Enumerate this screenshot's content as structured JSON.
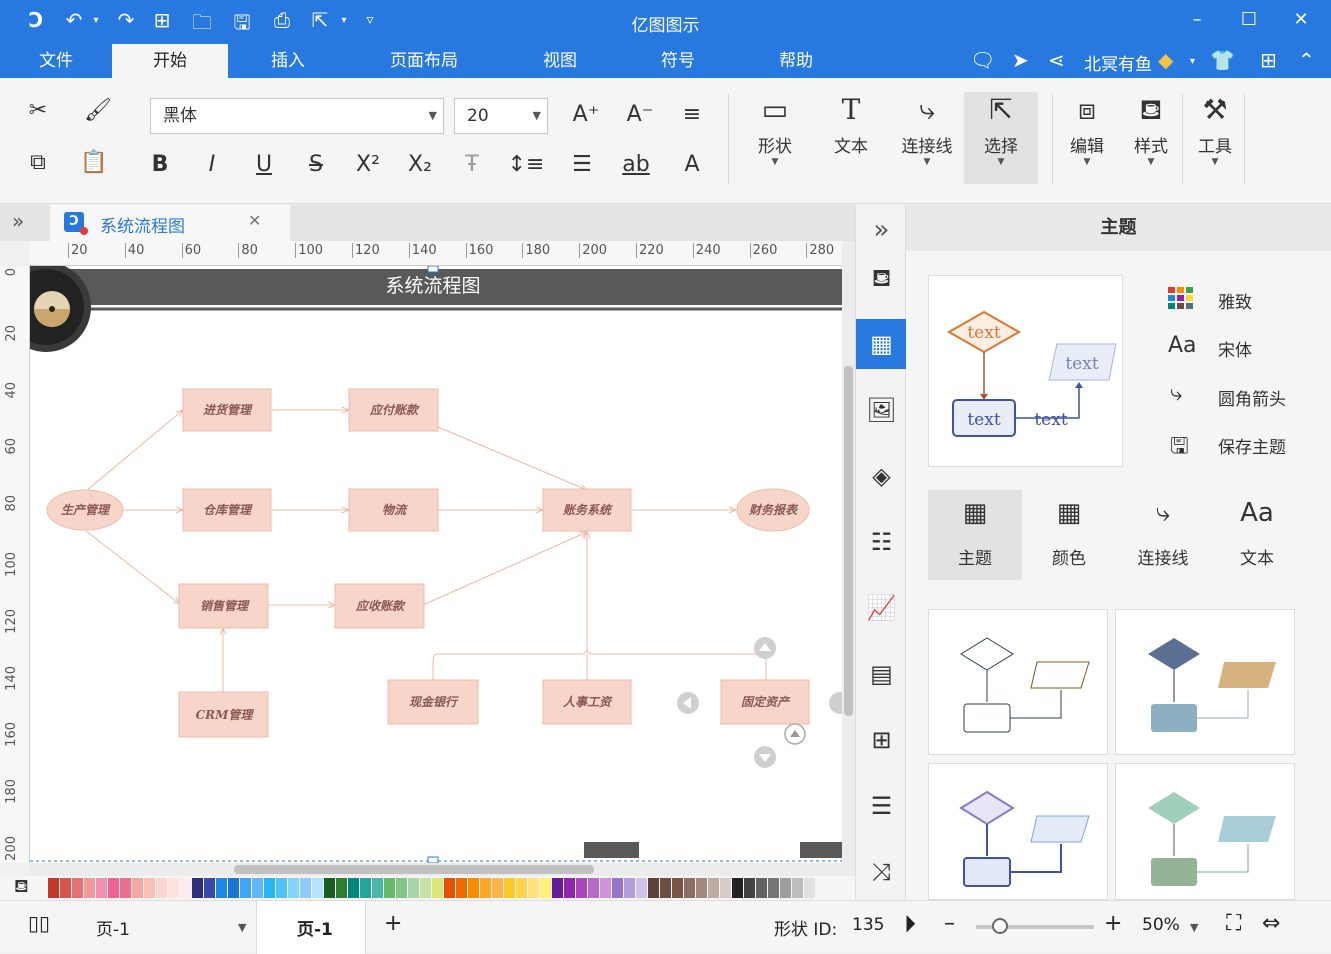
{
  "app": {
    "title": "亿图图示"
  },
  "menu": {
    "items": [
      "文件",
      "开始",
      "插入",
      "页面布局",
      "视图",
      "符号",
      "帮助"
    ],
    "active": "开始"
  },
  "user": {
    "name": "北冥有鱼"
  },
  "ribbon": {
    "font_name": "黑体",
    "font_size": "20",
    "big_buttons": {
      "shape": "形状",
      "text": "文本",
      "connector": "连接线",
      "select": "选择",
      "edit": "编辑",
      "style": "样式",
      "tools": "工具"
    }
  },
  "document": {
    "tab_title": "系统流程图",
    "diagram_title": "系统流程图"
  },
  "ruler": {
    "h": [
      "20",
      "40",
      "60",
      "80",
      "100",
      "120",
      "140",
      "160",
      "180",
      "200",
      "220",
      "240",
      "260",
      "280"
    ],
    "v": [
      "0",
      "20",
      "40",
      "60",
      "80",
      "100",
      "120",
      "140",
      "160",
      "180",
      "200"
    ]
  },
  "flowchart": {
    "nodes": {
      "production": "生产管理",
      "purchase": "进货管理",
      "payable": "应付账款",
      "warehouse": "仓库管理",
      "logistics": "物流",
      "accounting": "账务系统",
      "report": "财务报表",
      "sales": "销售管理",
      "receivable": "应收账款",
      "crm": "CRM管理",
      "cash": "现金银行",
      "payroll": "人事工资",
      "assets": "固定资产"
    }
  },
  "panel": {
    "title": "主题",
    "preview_text": "text",
    "options": {
      "font_style": "雅致",
      "font": "宋体",
      "connector": "圆角箭头",
      "save": "保存主题"
    },
    "tabs": {
      "theme": "主题",
      "color": "颜色",
      "connector": "连接线",
      "text": "文本"
    },
    "font_icon": "Aa"
  },
  "status": {
    "page_select": "页-1",
    "page_tab": "页-1",
    "shape_id_label": "形状 ID:",
    "shape_id": "135",
    "zoom": "50%",
    "zoom_level": 0.2
  },
  "colors": {
    "brand": "#2779df",
    "node_fill": "#f7d5c9",
    "node_stroke": "#eebcab",
    "node_text": "#8a5a52",
    "title_band": "#595959"
  },
  "palette": [
    "#c0392b",
    "#d9534f",
    "#e57373",
    "#ef9a9a",
    "#f48fb1",
    "#f06292",
    "#ec6f90",
    "#f4a6a0",
    "#f8c0b8",
    "#fbd3cf",
    "#fde3e0",
    "#fcecec",
    "#2c2f7a",
    "#3949ab",
    "#1e88e5",
    "#1976d2",
    "#42a5f5",
    "#64b5f6",
    "#29b6f6",
    "#4fc3f7",
    "#81d4fa",
    "#90caf9",
    "#b3e5fc",
    "#1b5e20",
    "#2e7d32",
    "#00897b",
    "#26a69a",
    "#4db6ac",
    "#66bb6a",
    "#81c784",
    "#a5d6a7",
    "#c5e1a5",
    "#dce775",
    "#e65100",
    "#ef6c00",
    "#fb8c00",
    "#ffa726",
    "#ffb74d",
    "#ffca28",
    "#ffd54f",
    "#ffe082",
    "#fff176",
    "#6a1b9a",
    "#8e24aa",
    "#ab47bc",
    "#ba68c8",
    "#ce93d8",
    "#9575cd",
    "#b39ddb",
    "#d1c4e9",
    "#5d4037",
    "#6d4c41",
    "#795548",
    "#8d6e63",
    "#a1887f",
    "#bcaaa4",
    "#d7ccc8",
    "#212121",
    "#424242",
    "#616161",
    "#757575",
    "#9e9e9e",
    "#bdbdbd",
    "#e0e0e0",
    "#f5f5f5"
  ]
}
